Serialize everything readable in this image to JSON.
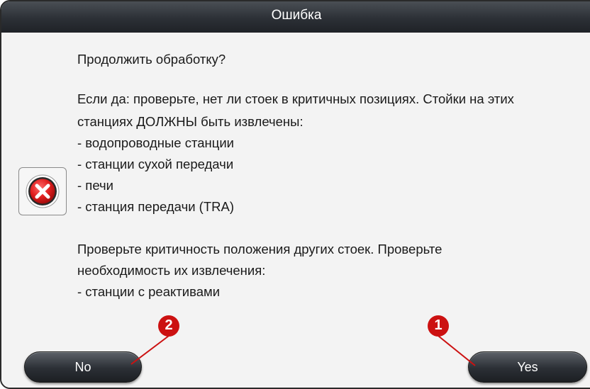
{
  "dialog": {
    "title": "Ошибка",
    "message_lines": [
      "Продолжить обработку?",
      "Если да: проверьте, нет ли стоек в критичных позициях. Стойки на этих",
      "станциях ДОЛЖНЫ быть извлечены:",
      "- водопроводные станции",
      "- станции сухой передачи",
      "- печи",
      "- станция передачи (TRA)",
      "Проверьте критичность положения других стоек. Проверьте",
      "необходимость их извлечения:",
      "- станции с реактивами"
    ],
    "icon": "error-x-icon",
    "buttons": {
      "no_label": "No",
      "yes_label": "Yes"
    }
  },
  "callouts": {
    "no_number": "2",
    "yes_number": "1",
    "color": "#cc1111"
  }
}
